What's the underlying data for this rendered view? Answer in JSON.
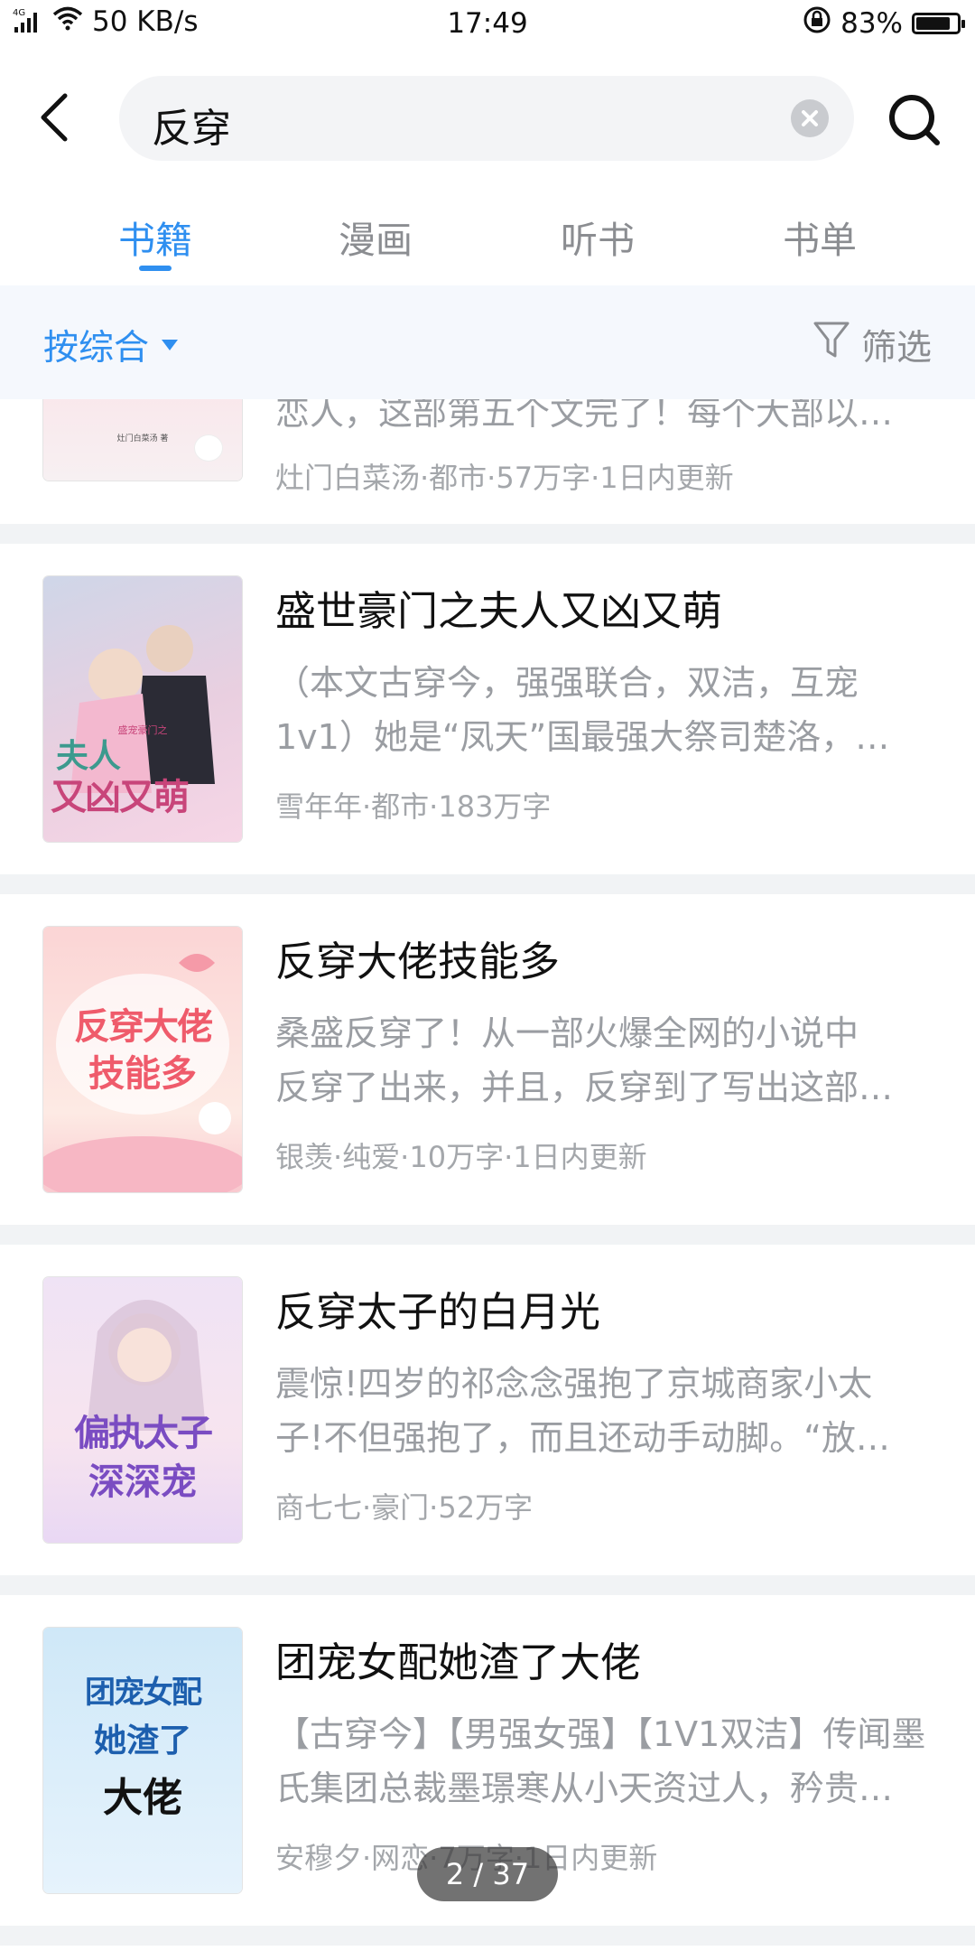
{
  "status_bar": {
    "network": "4G",
    "speed": "50 KB/s",
    "time": "17:49",
    "battery": "83%",
    "battery_level": 0.83
  },
  "search": {
    "query": "反穿"
  },
  "tabs": [
    {
      "label": "书籍",
      "active": true
    },
    {
      "label": "漫画",
      "active": false
    },
    {
      "label": "听书",
      "active": false
    },
    {
      "label": "书单",
      "active": false
    }
  ],
  "filter_bar": {
    "sort_label": "按综合",
    "filter_label": "筛选"
  },
  "partial_item": {
    "desc": "恋人，这部第五个文完了！每个大部以…",
    "meta": "灶门白菜汤·都市·57万字·1日内更新",
    "cover_text": "灶门白菜汤 著"
  },
  "books": [
    {
      "title": "盛世豪门之夫人又凶又萌",
      "desc_lines": [
        "（本文古穿今，强强联合，双洁，互宠",
        "1v1）她是“凤天”国最强大祭司楚洛，…"
      ],
      "meta": "雪年年·都市·183万字",
      "cover_lines": [
        "盛宠豪门之",
        "夫人",
        "又凶又萌"
      ],
      "colors": {
        "bg1": "#d8cfe6",
        "bg2": "#f3c9dc",
        "text": "#3c9a8e"
      }
    },
    {
      "title": "反穿大佬技能多",
      "desc_lines": [
        "桑盛反穿了！从一部火爆全网的小说中",
        "反穿了出来，并且，反穿到了写出这部…"
      ],
      "meta": "银羡·纯爱·10万字·1日内更新",
      "cover_lines": [
        "反穿大佬",
        "技能多"
      ],
      "colors": {
        "bg1": "#fbd3d3",
        "bg2": "#fbe8e0",
        "text": "#ef5b6b"
      }
    },
    {
      "title": "反穿太子的白月光",
      "desc_lines": [
        "震惊!四岁的祁念念强抱了京城商家小太",
        "子!不但强抱了，而且还动手动脚。“放…"
      ],
      "meta": "商七七·豪门·52万字",
      "cover_lines": [
        "偏执太子",
        "深深宠"
      ],
      "colors": {
        "bg1": "#e6dcf3",
        "bg2": "#f6e8f3",
        "text": "#7a4cc2"
      }
    },
    {
      "title": "团宠女配她渣了大佬",
      "desc_lines": [
        "【古穿今】【男强女强】【1V1双洁】传闻墨",
        "氏集团总裁墨璟寒从小天资过人，矜贵…"
      ],
      "meta": "安穆夕·网恋·7万字·1日内更新",
      "cover_lines": [
        "团宠女配",
        "她渣了",
        "大佬"
      ],
      "colors": {
        "bg1": "#bfe0f5",
        "bg2": "#e3f1fb",
        "text": "#1d5fae"
      }
    }
  ],
  "pager": {
    "text": "2 / 37"
  }
}
